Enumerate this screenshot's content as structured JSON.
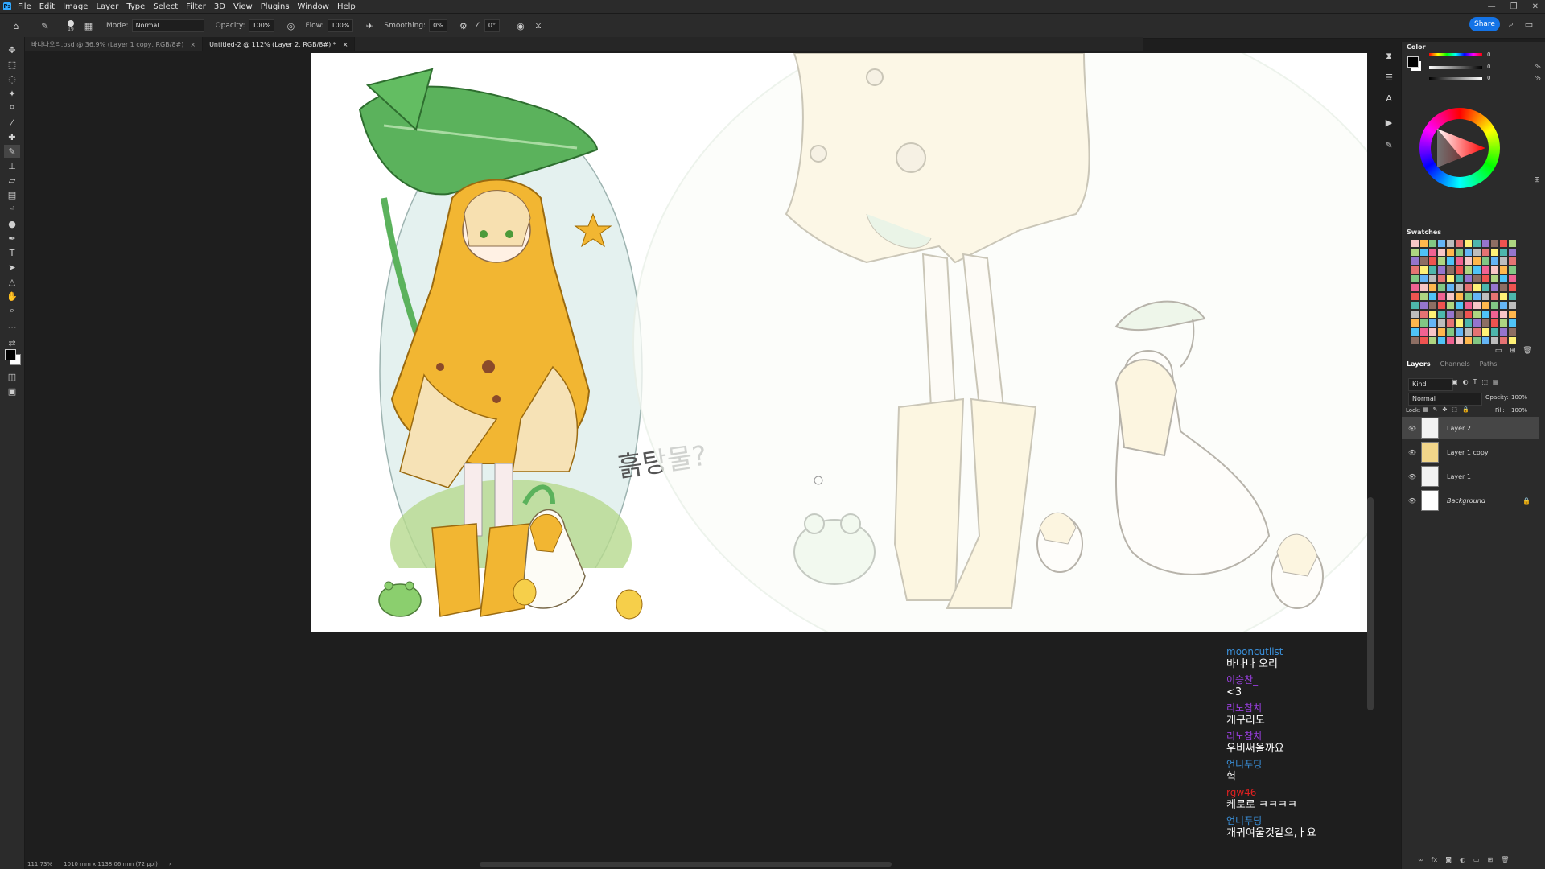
{
  "app": {
    "name": "Photoshop",
    "badge": "Ps"
  },
  "menu": [
    "File",
    "Edit",
    "Image",
    "Layer",
    "Type",
    "Select",
    "Filter",
    "3D",
    "View",
    "Plugins",
    "Window",
    "Help"
  ],
  "window_controls": [
    "minimize-icon",
    "restore-icon",
    "close-icon"
  ],
  "options": {
    "brush_size": "19",
    "mode_label": "Mode:",
    "mode_value": "Normal",
    "opacity_label": "Opacity:",
    "opacity_value": "100%",
    "flow_label": "Flow:",
    "flow_value": "100%",
    "smoothing_label": "Smoothing:",
    "smoothing_value": "0%",
    "angle_value": "0°",
    "share_label": "Share"
  },
  "tabs": [
    {
      "label": "바나나오리.psd @ 36.9% (Layer 1 copy, RGB/8#)",
      "active": false
    },
    {
      "label": "Untitled-2 @ 112% (Layer 2, RGB/8#) *",
      "active": true
    }
  ],
  "canvas": {
    "handwriting": "흙탕물?"
  },
  "status": {
    "zoom": "111.73%",
    "doc_size": "1010 mm x 1138.06 mm (72 ppi)"
  },
  "chat": [
    {
      "user": "mooncutlist",
      "color": "#3a8fd8",
      "message": "바나나 오리"
    },
    {
      "user": "이승찬_",
      "color": "#9a3fe0",
      "message": "<3"
    },
    {
      "user": "리노참치",
      "color": "#9a3fe0",
      "message": "개구리도"
    },
    {
      "user": "리노참치",
      "color": "#9a3fe0",
      "message": "우비써올까요"
    },
    {
      "user": "언니푸딩",
      "color": "#3a8fd8",
      "message": "헉"
    },
    {
      "user": "rgw46",
      "color": "#e02020",
      "message": "케로로 ㅋㅋㅋㅋ"
    },
    {
      "user": "언니푸딩",
      "color": "#3a8fd8",
      "message": "개귀여울것같으,ㅏ요"
    }
  ],
  "color_panel": {
    "title": "Color",
    "slider_values": [
      "0",
      "0",
      "0"
    ],
    "slider_units": [
      "%",
      "%",
      "%"
    ],
    "hue_icon": "color-wheel"
  },
  "swatches_panel": {
    "title": "Swatches"
  },
  "layers_panel": {
    "tabs": [
      "Layers",
      "Channels",
      "Paths"
    ],
    "kind_label": "Kind",
    "blend_mode": "Normal",
    "opacity_label": "Opacity:",
    "opacity_value": "100%",
    "lock_label": "Lock:",
    "fill_label": "Fill:",
    "fill_value": "100%",
    "layers": [
      {
        "name": "Layer 2",
        "selected": true
      },
      {
        "name": "Layer 1 copy",
        "selected": false
      },
      {
        "name": "Layer 1",
        "selected": false
      },
      {
        "name": "Background",
        "selected": false,
        "locked": true
      }
    ]
  },
  "colors": {
    "accent": "#1473e6",
    "leaf": "#4caf50",
    "coat": "#f2b632"
  }
}
